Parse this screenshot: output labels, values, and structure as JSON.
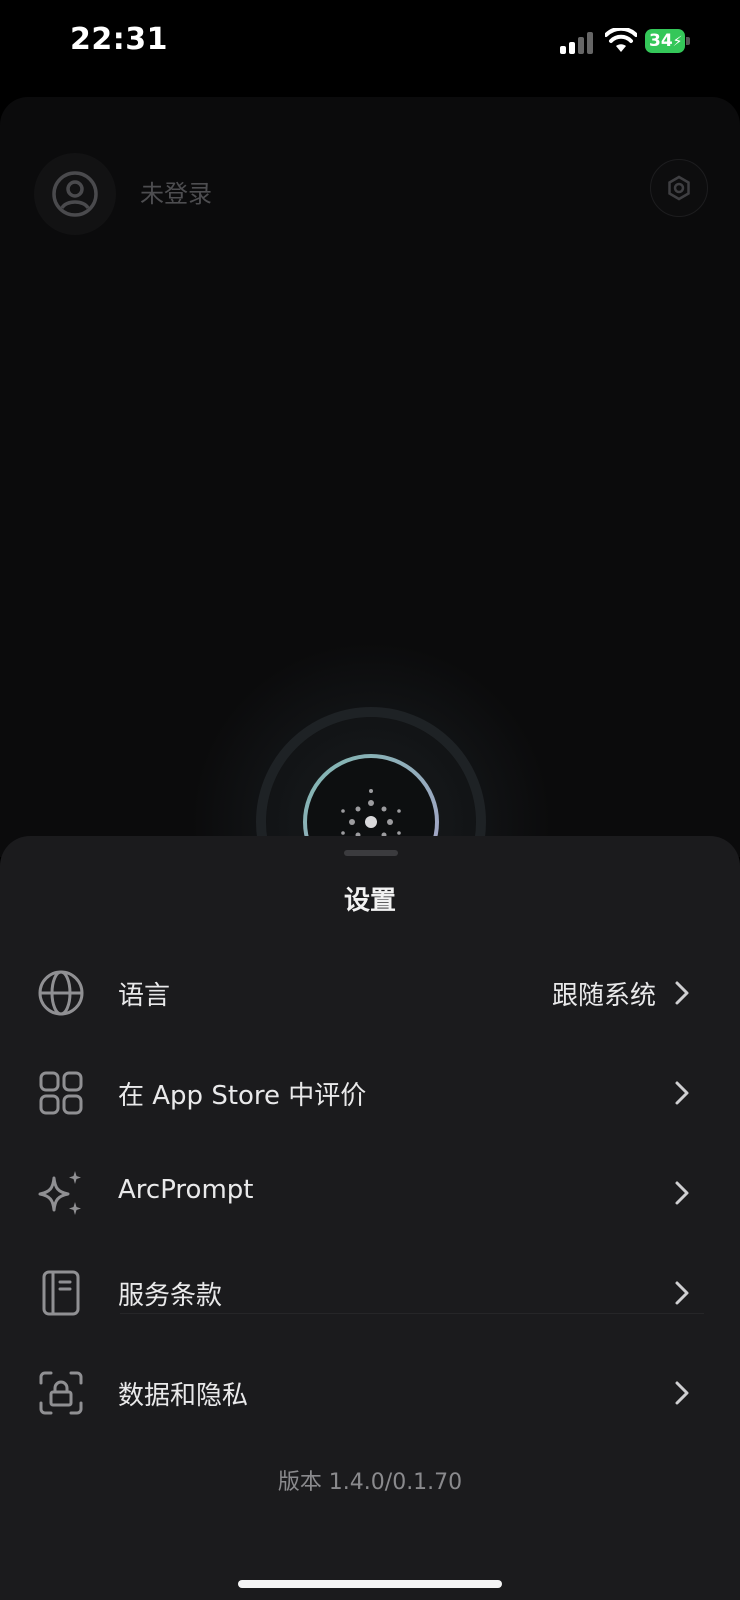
{
  "status_bar": {
    "time": "22:31",
    "battery": "34"
  },
  "profile": {
    "login_status": "未登录"
  },
  "settings_sheet": {
    "title": "设置",
    "items": [
      {
        "label": "语言",
        "value": "跟随系统",
        "icon": "globe-icon"
      },
      {
        "label": "在 App Store 中评价",
        "icon": "app-grid-icon"
      },
      {
        "label": "ArcPrompt",
        "icon": "sparkles-icon"
      },
      {
        "label": "服务条款",
        "icon": "notebook-icon"
      },
      {
        "label": "数据和隐私",
        "icon": "lock-scan-icon"
      }
    ],
    "version": "版本 1.4.0/0.1.70"
  },
  "colors": {
    "sheet_bg": "#1b1b1d",
    "battery_green": "#34c759",
    "text": "#e9e9ea",
    "muted": "#8a8a8d"
  }
}
